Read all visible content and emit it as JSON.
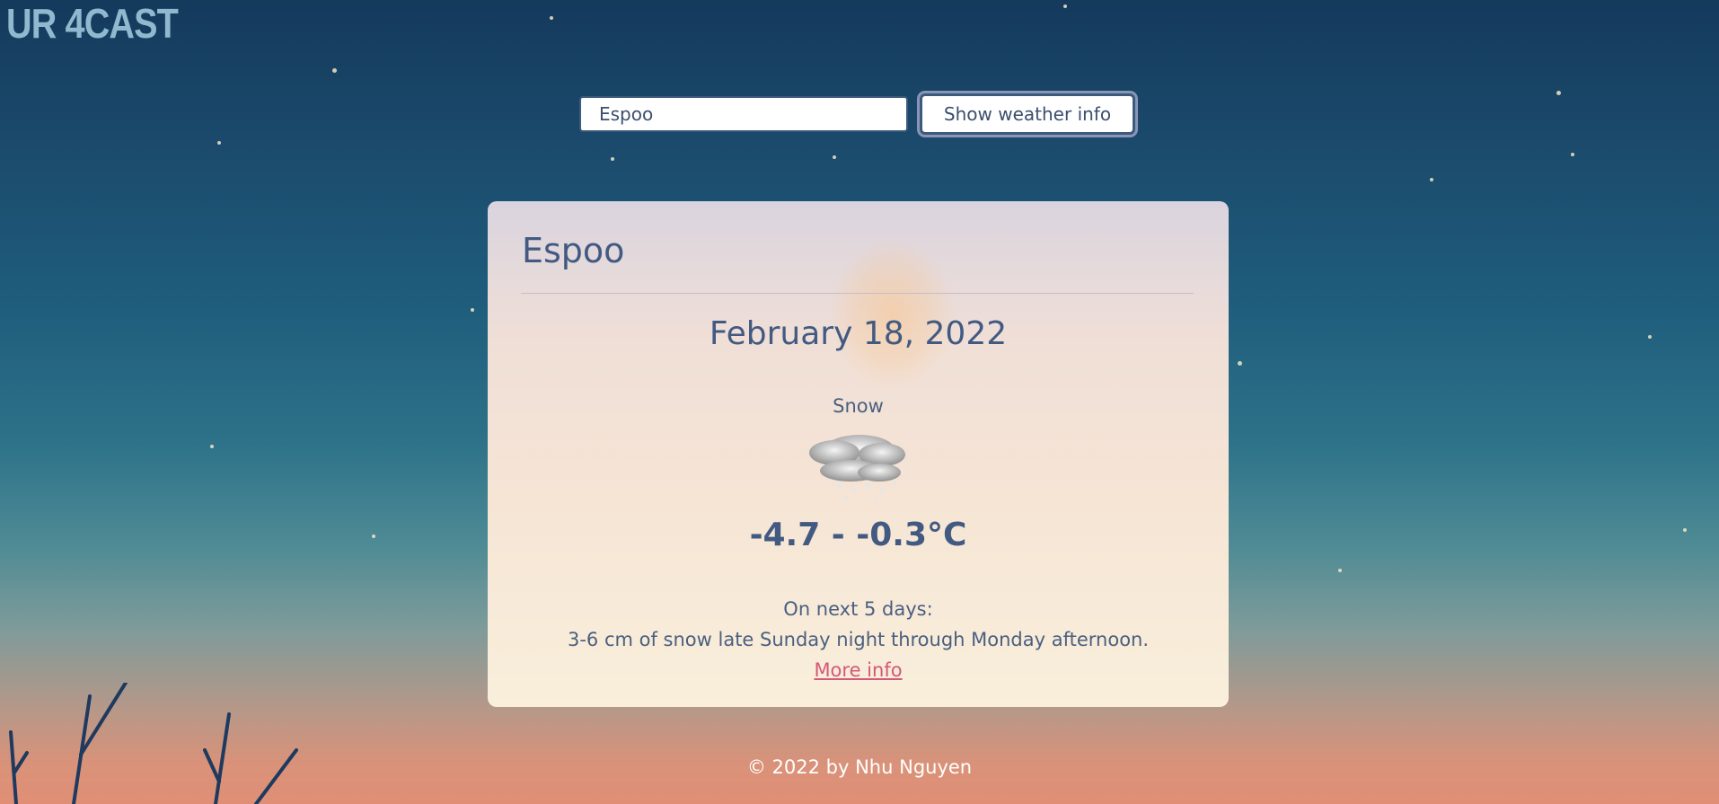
{
  "app": {
    "logo": "UR 4CAST"
  },
  "search": {
    "value": "Espoo",
    "button_label": "Show weather info"
  },
  "weather": {
    "city": "Espoo",
    "date": "February 18, 2022",
    "condition": "Snow",
    "icon": "snow-cloud-icon",
    "temperature_range": "-4.7 - -0.3°C",
    "forecast_heading": "On next 5 days:",
    "forecast_text": "3-6 cm of snow late Sunday night through Monday afternoon.",
    "more_info_label": "More info"
  },
  "footer": {
    "text": "© 2022 by Nhu Nguyen"
  },
  "colors": {
    "accent": "#425a82",
    "link": "#d4597a",
    "logo": "#8fb9cf"
  }
}
